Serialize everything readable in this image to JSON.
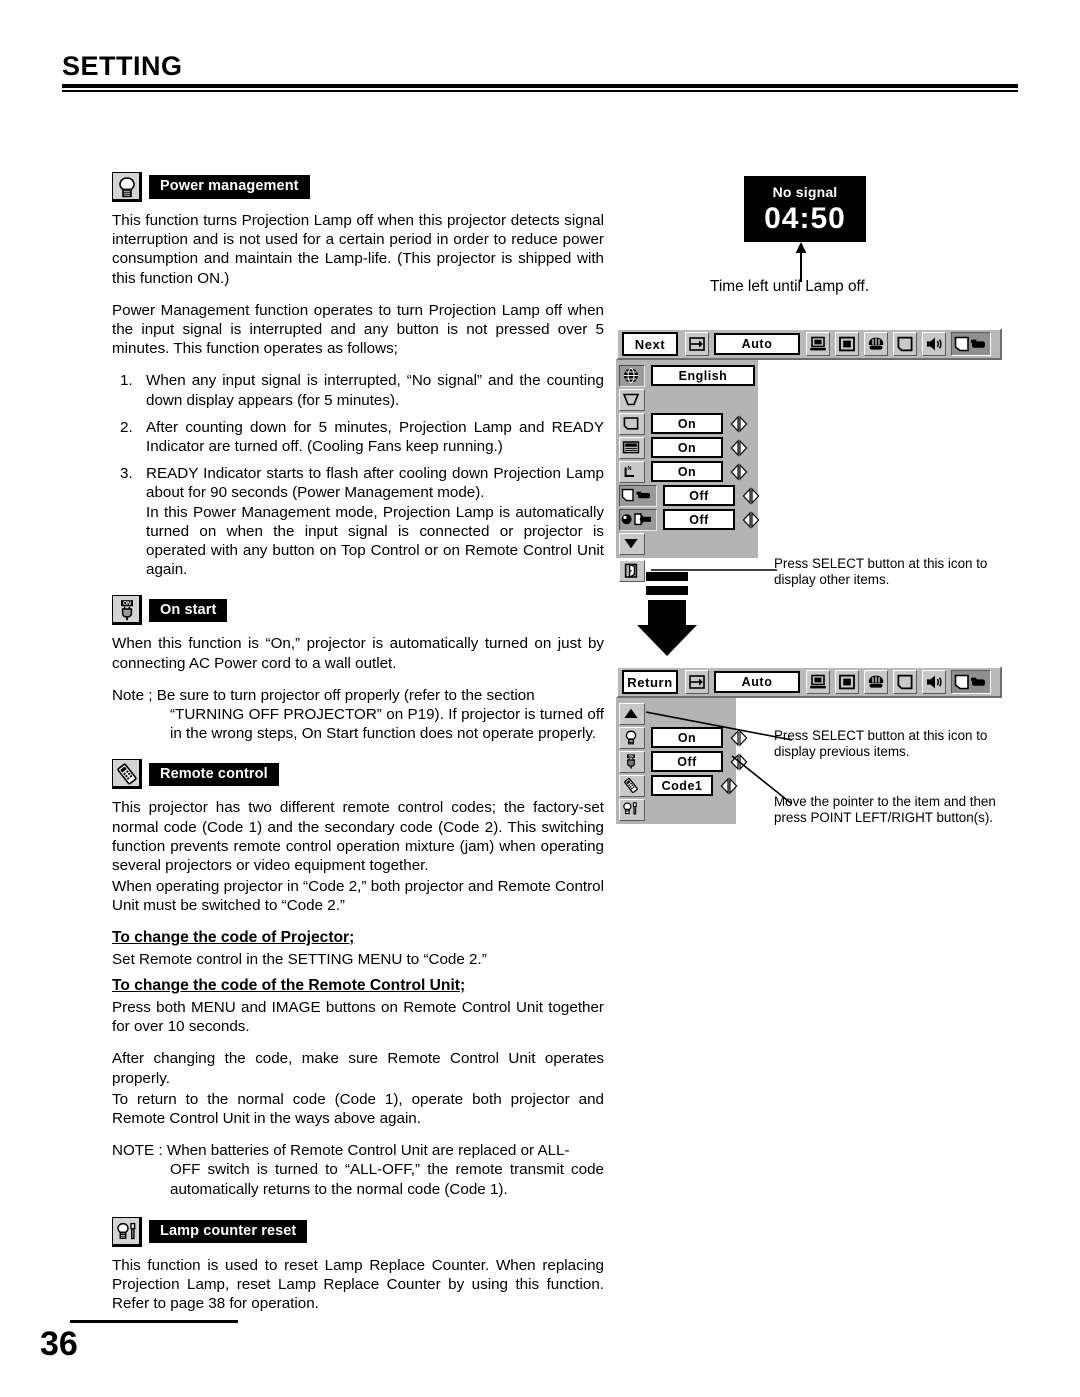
{
  "header": {
    "title": "SETTING"
  },
  "footer": {
    "page_number": "36"
  },
  "sections": {
    "power_management": {
      "icon": "lamp-icon",
      "label": "Power management",
      "p1": "This function turns Projection Lamp off when this projector detects signal interruption and is not used for a certain period in order to reduce power consumption and maintain the Lamp-life.  (This projector is shipped with this function ON.)",
      "p2": "Power Management function operates to turn Projection Lamp off when the input signal is interrupted and any button is not pressed over 5 minutes.  This function operates as follows;",
      "steps": [
        {
          "num": "1.",
          "text": "When any input signal is interrupted, “No signal” and the counting down display appears (for 5 minutes)."
        },
        {
          "num": "2.",
          "text": "After counting down for 5 minutes, Projection Lamp and READY Indicator are turned off.  (Cooling Fans keep running.)"
        },
        {
          "num": "3.",
          "text": "READY Indicator starts to flash after cooling down Projection Lamp about for 90 seconds (Power Management mode).",
          "sub": "In this Power Management mode, Projection Lamp is automatically turned on when the input signal is connected or projector is operated with any button on Top Control or on Remote Control Unit again."
        }
      ]
    },
    "on_start": {
      "icon": "on-plug-icon",
      "label": "On start",
      "p1": "When this function is “On,” projector is automatically turned on just by connecting AC Power cord to a wall outlet.",
      "note_label": "Note ;",
      "note_first": "Be sure to turn projector off properly (refer to the section",
      "note_body": "“TURNING OFF PROJECTOR” on P19).  If projector is turned off in the wrong steps, On Start function does not operate properly."
    },
    "remote_control": {
      "icon": "remote-control-icon",
      "label": "Remote control",
      "p1": "This projector has two different remote control codes; the factory-set normal code (Code 1) and the secondary code (Code 2).  This switching function prevents remote control operation mixture (jam) when operating several projectors or video equipment together.",
      "p2": "When operating projector in “Code 2,”  both projector and Remote Control Unit must be switched to “Code 2.”",
      "head1": "To change the code of Projector;",
      "p3": "Set Remote control in the SETTING MENU to “Code 2.”",
      "head2": "To change the code of the Remote Control Unit;",
      "p4": "Press both MENU and IMAGE buttons on Remote Control Unit together for over 10 seconds.",
      "p5": "After changing the code, make sure Remote Control Unit operates properly.",
      "p6": "To return to the normal code (Code 1), operate both projector and Remote Control Unit in the ways above again.",
      "note_label": "NOTE :",
      "note_first": "When batteries of Remote Control Unit are replaced or ALL-",
      "note_body": "OFF switch is turned to “ALL-OFF,” the remote transmit code automatically returns to the normal code (Code 1)."
    },
    "lamp_counter_reset": {
      "icon": "lamp-tool-icon",
      "label": "Lamp counter reset",
      "p1": "This function is used to reset Lamp Replace Counter.  When replacing Projection Lamp, reset Lamp Replace Counter by using this function.  Refer to page 38 for operation."
    }
  },
  "osd": {
    "no_signal": {
      "label": "No signal",
      "time": "04:50"
    },
    "caption_time_left": "Time left until Lamp off.",
    "menu1": {
      "nav_label": "Next",
      "auto_label": "Auto",
      "toolbar_icons": [
        "input-icon",
        "pc-adjust-auto",
        "computer-icon",
        "screen-icon",
        "image-icon",
        "page-icon",
        "sound-icon",
        "setting-icon"
      ],
      "rows": [
        {
          "icon": "language-globe-icon",
          "value": "English",
          "arrows": false,
          "selected": true
        },
        {
          "icon": "keystone-icon",
          "value": "",
          "arrows": false,
          "selected": false
        },
        {
          "icon": "blue-back-icon",
          "value": "On",
          "arrows": true,
          "selected": false
        },
        {
          "icon": "display-icon",
          "value": "On",
          "arrows": true,
          "selected": false
        },
        {
          "icon": "logo-icon",
          "value": "On",
          "arrows": true,
          "selected": false
        },
        {
          "icon": "ceiling-icon",
          "value": "Off",
          "arrows": true,
          "selected": true
        },
        {
          "icon": "rear-icon",
          "value": "Off",
          "arrows": true,
          "selected": true
        },
        {
          "icon": "scroll-down-icon",
          "value": "",
          "arrows": false,
          "selected": false
        },
        {
          "icon": "exit-door-icon",
          "value": "",
          "arrows": false,
          "selected": false
        }
      ],
      "callout": "Press SELECT button at this icon to display other items."
    },
    "menu2": {
      "nav_label": "Return",
      "auto_label": "Auto",
      "rows": [
        {
          "icon": "scroll-up-icon",
          "value": "",
          "arrows": false,
          "selected": false
        },
        {
          "icon": "power-management-lamp-icon",
          "value": "On",
          "arrows": true,
          "selected": false
        },
        {
          "icon": "on-start-plug-icon",
          "value": "Off",
          "arrows": true,
          "selected": false
        },
        {
          "icon": "remote-control-icon",
          "value": "Code1",
          "arrows": true,
          "selected": false
        },
        {
          "icon": "lamp-counter-reset-icon",
          "value": "",
          "arrows": false,
          "selected": false
        }
      ],
      "callout1": "Press SELECT button at this icon to display previous items.",
      "callout2": "Move the pointer to the item and then press POINT LEFT/RIGHT button(s)."
    }
  }
}
